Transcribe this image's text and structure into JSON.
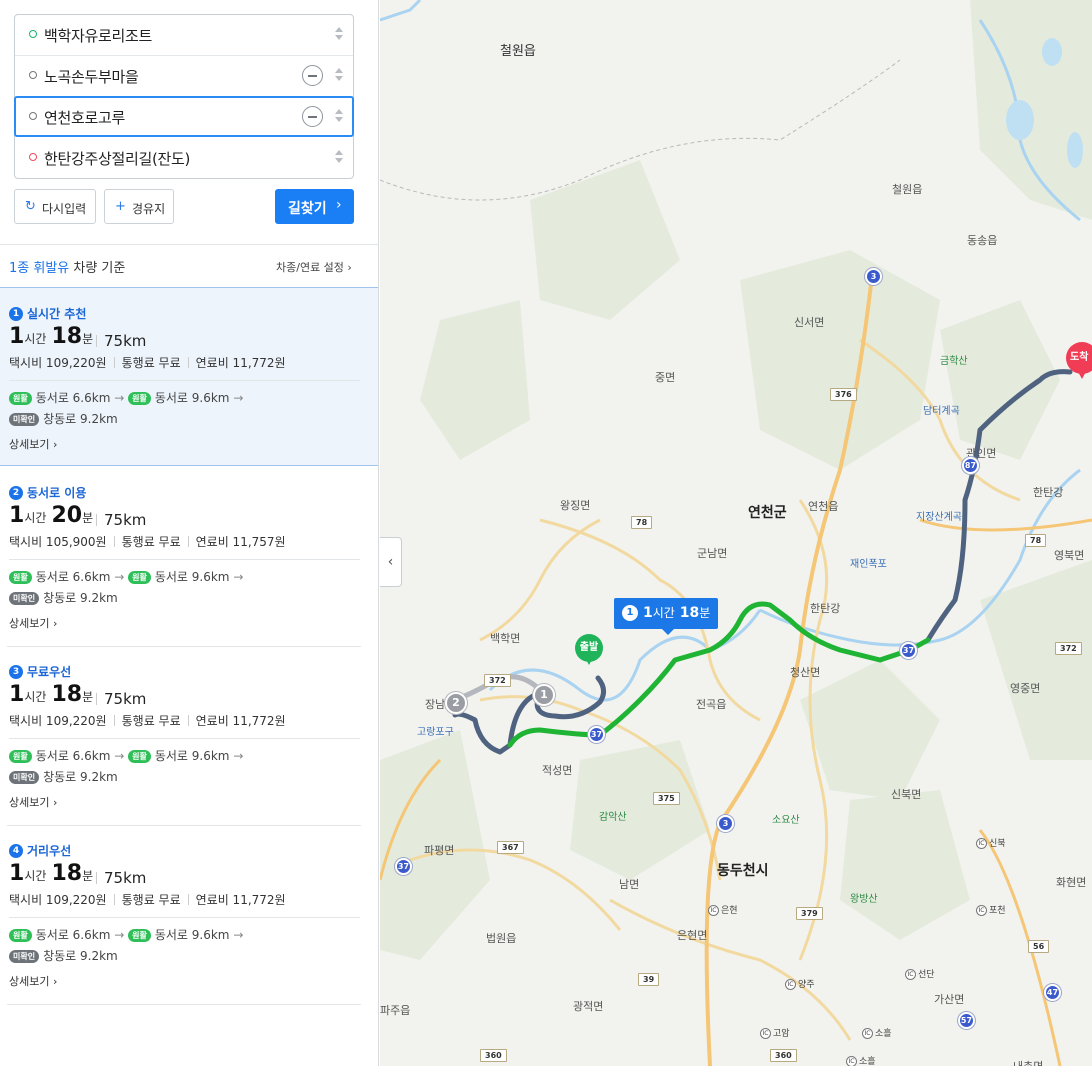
{
  "waypoints": [
    {
      "label": "백학자유로리조트",
      "type": "start"
    },
    {
      "label": "노곡손두부마을",
      "type": "via"
    },
    {
      "label": "연천호로고루",
      "type": "via"
    },
    {
      "label": "한탄강주상절리길(잔도)",
      "type": "goal"
    }
  ],
  "actions": {
    "reset_label": "다시입력",
    "reset_icon": "refresh-icon",
    "add_via_label": "경유지",
    "add_via_icon": "plus-icon",
    "search_label": "길찾기",
    "search_arrow": "›"
  },
  "vehicle": {
    "highlight": "1종 휘발유",
    "rest": " 차량 기준",
    "settings_label": "차종/연료 설정 ›"
  },
  "routes": [
    {
      "index": "1",
      "name": "실시간 추천",
      "hours": "1",
      "hour_unit": "시간",
      "minutes": "18",
      "minute_unit": "분",
      "distance": "75km",
      "taxi": "택시비 109,220원",
      "toll": "통행료 무료",
      "fuel": "연료비 11,772원",
      "badge1": "원활",
      "road1": "동서로 6.6km",
      "badge2": "원활",
      "road2": "동서로 9.6km",
      "badge3": "미확인",
      "road3": "창동로 9.2km",
      "more": "상세보기 ›",
      "selected": true
    },
    {
      "index": "2",
      "name": "동서로 이용",
      "hours": "1",
      "hour_unit": "시간",
      "minutes": "20",
      "minute_unit": "분",
      "distance": "75km",
      "taxi": "택시비 105,900원",
      "toll": "통행료 무료",
      "fuel": "연료비 11,757원",
      "badge1": "원활",
      "road1": "동서로 6.6km",
      "badge2": "원활",
      "road2": "동서로 9.6km",
      "badge3": "미확인",
      "road3": "창동로 9.2km",
      "more": "상세보기 ›",
      "selected": false
    },
    {
      "index": "3",
      "name": "무료우선",
      "hours": "1",
      "hour_unit": "시간",
      "minutes": "18",
      "minute_unit": "분",
      "distance": "75km",
      "taxi": "택시비 109,220원",
      "toll": "통행료 무료",
      "fuel": "연료비 11,772원",
      "badge1": "원활",
      "road1": "동서로 6.6km",
      "badge2": "원활",
      "road2": "동서로 9.6km",
      "badge3": "미확인",
      "road3": "창동로 9.2km",
      "more": "상세보기 ›",
      "selected": false
    },
    {
      "index": "4",
      "name": "거리우선",
      "hours": "1",
      "hour_unit": "시간",
      "minutes": "18",
      "minute_unit": "분",
      "distance": "75km",
      "taxi": "택시비 109,220원",
      "toll": "통행료 무료",
      "fuel": "연료비 11,772원",
      "badge1": "원활",
      "road1": "동서로 6.6km",
      "badge2": "원활",
      "road2": "동서로 9.6km",
      "badge3": "미확인",
      "road3": "창동로 9.2km",
      "more": "상세보기 ›",
      "selected": false
    }
  ],
  "map": {
    "route_label": {
      "index": "1",
      "hours": "1",
      "hour_unit": "시간",
      "minutes": "18",
      "minute_unit": "분"
    },
    "start_label": "출발",
    "goal_label": "도착",
    "collapse_glyph": "‹",
    "waypoint_markers": [
      "1",
      "2"
    ],
    "place_labels": [
      "철원읍",
      "철원읍",
      "동송읍",
      "신서면",
      "중면",
      "금학산",
      "담터계곡",
      "관인면",
      "한탄강",
      "영북면",
      "왕징면",
      "연천군",
      "연천읍",
      "지장산계곡",
      "군남면",
      "재인폭포",
      "백학면",
      "한탄강",
      "청산면",
      "장남면",
      "고랑포구",
      "전곡읍",
      "영중면",
      "적성면",
      "감악산",
      "소요산",
      "신북면",
      "파평면",
      "동두천시",
      "남면",
      "왕방산",
      "화현면",
      "법원읍",
      "은현면",
      "광적면",
      "가산면",
      "파주읍",
      "내촌면"
    ],
    "route_shields": [
      "3",
      "87",
      "37",
      "37",
      "3",
      "37",
      "47",
      "57"
    ],
    "national_roads": [
      "376",
      "78",
      "78",
      "372",
      "372",
      "375",
      "367",
      "379",
      "39",
      "56",
      "360",
      "360"
    ],
    "ic_labels": [
      "신북",
      "은현",
      "포천",
      "선단",
      "양주",
      "고암",
      "소흘",
      "소흘"
    ],
    "colors": {
      "route_main": "#1fb434",
      "route_alt": "#4f6381",
      "accent": "#1a7ef5",
      "goal": "#f03c55",
      "start": "#20b45a"
    }
  }
}
